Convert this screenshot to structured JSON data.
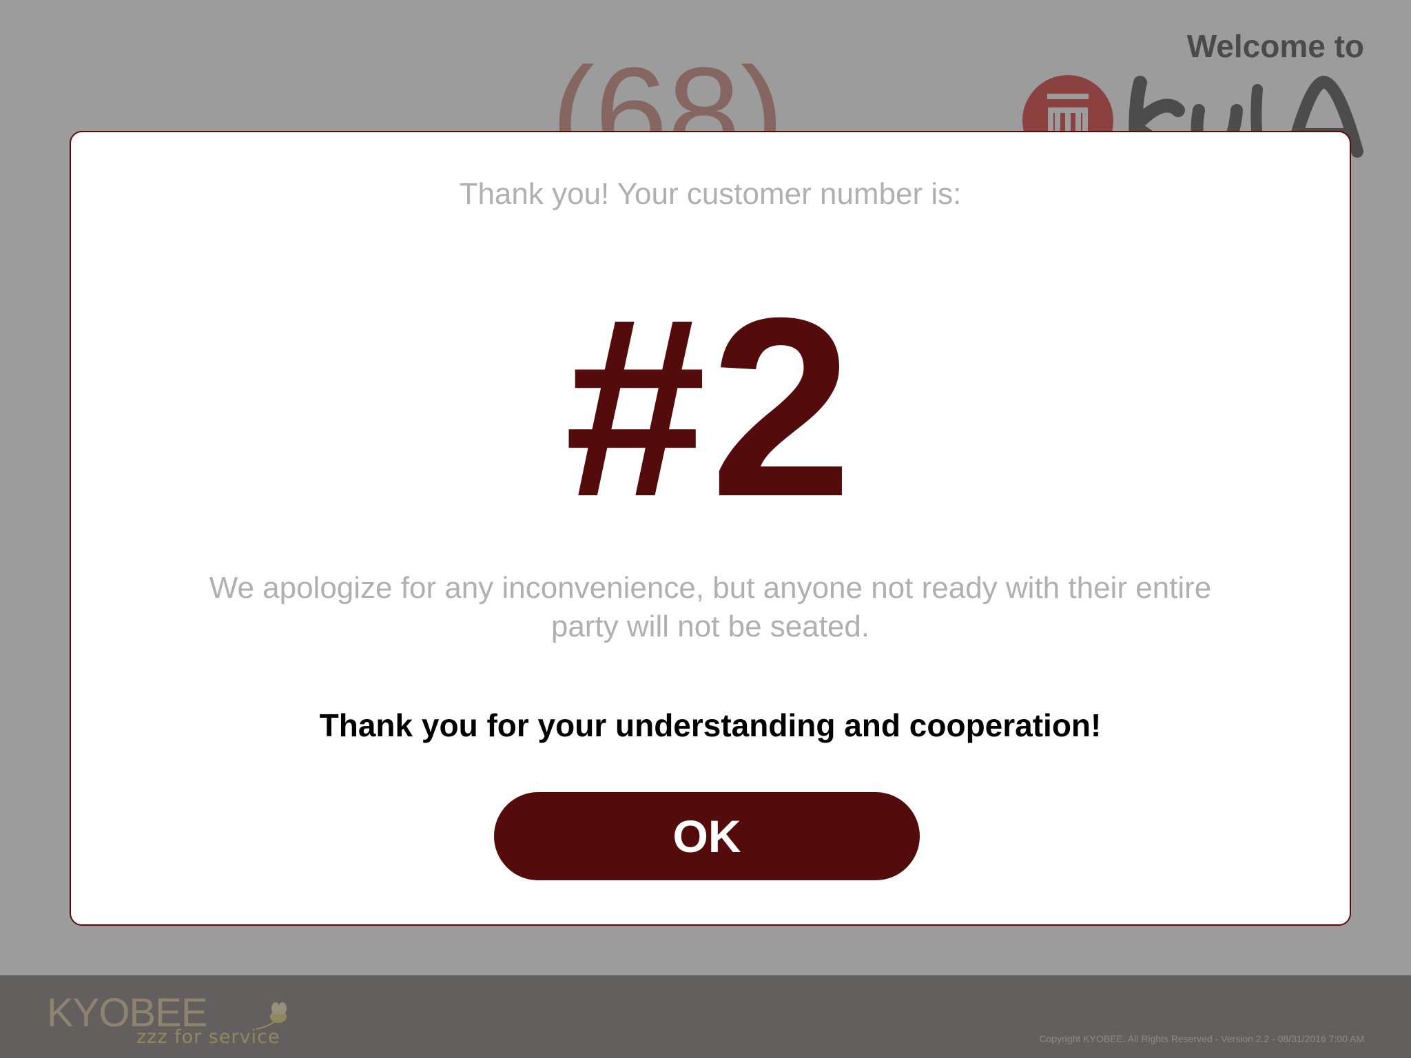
{
  "background": {
    "welcome_text": "Welcome to",
    "party_count_text": "(68)",
    "brand_logo_icon": "kula-sushi-logo-icon"
  },
  "modal": {
    "intro": "Thank you! Your customer number is:",
    "customer_number": "#2",
    "apology": "We apologize for any inconvenience, but anyone not ready with their entire party will not be seated.",
    "thanks": "Thank you for your understanding and cooperation!",
    "ok_label": "OK"
  },
  "footer": {
    "logo_main": "KYOBEE",
    "logo_tagline": "zzz for service",
    "bee_icon": "bee-icon",
    "copyright": "Copyright KYOBEE. All Rights Reserved - Version 2.2 - 08/31/2016 7:00 AM"
  },
  "colors": {
    "accent": "#530b0b",
    "muted_text": "#b0b0b0",
    "overlay": "rgba(0,0,0,0.39)",
    "footer_bg": "#a29b9b"
  }
}
